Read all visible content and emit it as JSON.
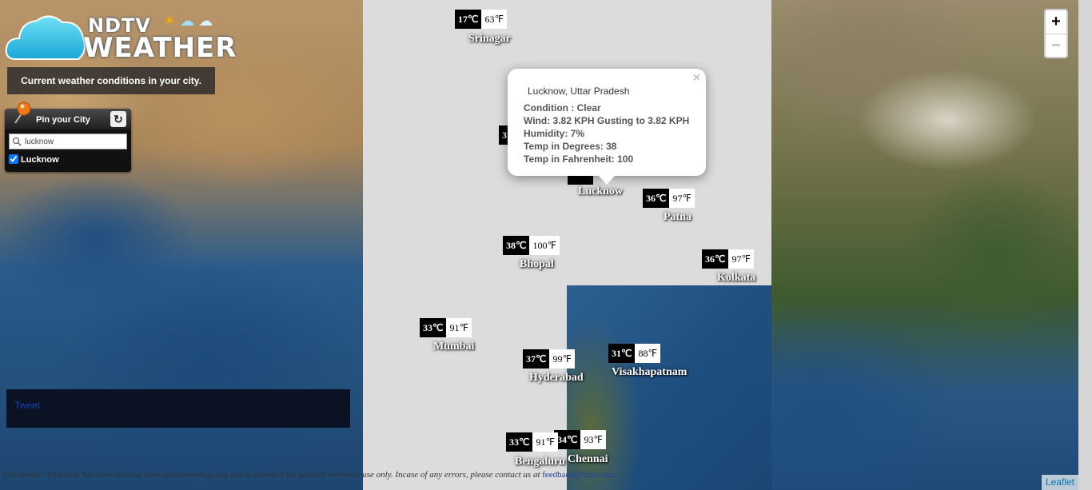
{
  "brand": {
    "name_top": "NDTV",
    "name_bottom": "WEATHER",
    "tagline": "Current weather conditions in your city."
  },
  "pin_panel": {
    "title": "Pin your City",
    "search_value": "lucknow",
    "checked_city": "Lucknow"
  },
  "tweet_label": "Tweet",
  "zoom": {
    "in": "+",
    "out": "−"
  },
  "popup": {
    "title": "Lucknow, Uttar Pradesh",
    "close": "×",
    "condition": "Condition : Clear",
    "wind": "Wind: 3.82 KPH Gusting to 3.82 KPH",
    "humidity": "Humidity: 7%",
    "temp_deg": "Temp in Degrees: 38",
    "temp_f": "Temp in Fahrenheit: 100"
  },
  "cities": {
    "srinagar": {
      "name": "Srinagar",
      "c": "17℃",
      "f": "63℉"
    },
    "lucknow": {
      "name": "Lucknow"
    },
    "patna": {
      "name": "Patna",
      "c": "36℃",
      "f": "97℉"
    },
    "bhopal": {
      "name": "Bhopal",
      "c": "38℃",
      "f": "100℉"
    },
    "kolkata": {
      "name": "Kolkata",
      "c": "36℃",
      "f": "97℉"
    },
    "mumbai": {
      "name": "Mumbai",
      "c": "33℃",
      "f": "91℉"
    },
    "hyderabad": {
      "name": "Hyderabad",
      "c": "37℃",
      "f": "99℉"
    },
    "visakhapatnam": {
      "name": "Visakhapatnam",
      "c": "31℃",
      "f": "88℉"
    },
    "bengaluru": {
      "name": "Bengaluru",
      "c": "33℃",
      "f": "91℉"
    },
    "chennai": {
      "name": "Chennai",
      "c": "34℃",
      "f": "93℉"
    },
    "hidden_marker": {
      "c": "3"
    }
  },
  "disclaimer": {
    "text": "Disclaimer: This map has been derived from openstreetmap.org and is intended for general reference use only. Incase of any errors, please contact us at",
    "email": "feedback@ndtv.com"
  },
  "attribution": "Leaflet"
}
